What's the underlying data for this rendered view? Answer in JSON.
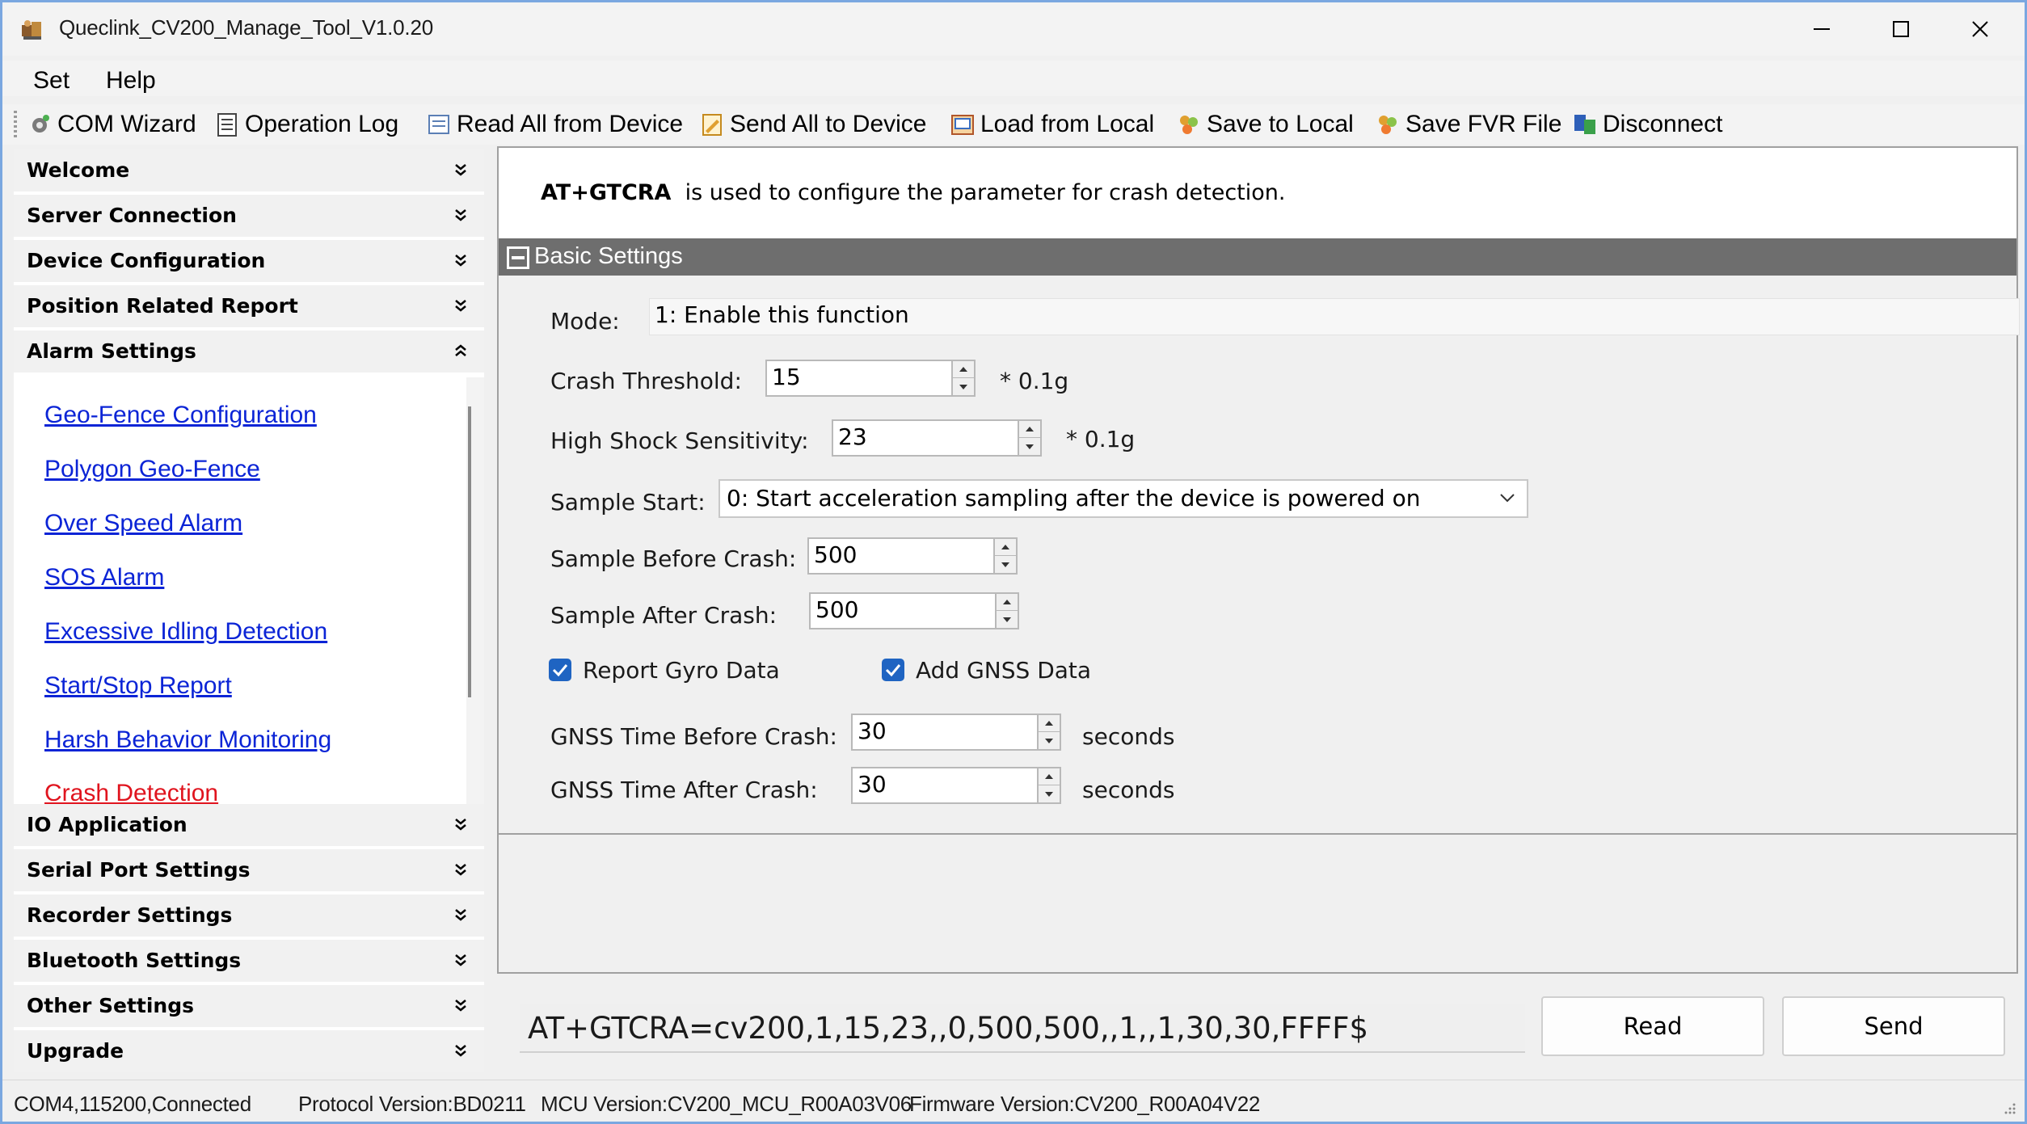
{
  "window": {
    "title": "Queclink_CV200_Manage_Tool_V1.0.20",
    "controls": {
      "minimize": "minimize",
      "maximize": "maximize",
      "close": "close"
    }
  },
  "menu": {
    "items": [
      "Set",
      "Help"
    ]
  },
  "toolbar": {
    "items": [
      {
        "label": "COM Wizard",
        "icon": "gear-icon"
      },
      {
        "label": "Operation Log",
        "icon": "log-icon"
      },
      {
        "label": "Read All from Device",
        "icon": "read-icon"
      },
      {
        "label": "Send All to Device",
        "icon": "send-icon"
      },
      {
        "label": "Load from Local",
        "icon": "load-icon"
      },
      {
        "label": "Save to Local",
        "icon": "save-icon"
      },
      {
        "label": "Save FVR File",
        "icon": "save-fvr-icon"
      },
      {
        "label": "Disconnect",
        "icon": "disconnect-icon"
      }
    ]
  },
  "sidebar": {
    "sections_top": [
      {
        "label": "Welcome",
        "state": "collapsed"
      },
      {
        "label": "Server Connection",
        "state": "collapsed"
      },
      {
        "label": "Device Configuration",
        "state": "collapsed"
      },
      {
        "label": "Position Related Report",
        "state": "collapsed"
      },
      {
        "label": "Alarm Settings",
        "state": "expanded"
      }
    ],
    "alarm_items": [
      {
        "label": "Geo-Fence Configuration",
        "active": false
      },
      {
        "label": "Polygon Geo-Fence",
        "active": false
      },
      {
        "label": "Over Speed Alarm",
        "active": false
      },
      {
        "label": "SOS Alarm",
        "active": false
      },
      {
        "label": "Excessive Idling Detection",
        "active": false
      },
      {
        "label": "Start/Stop Report",
        "active": false
      },
      {
        "label": "Harsh Behavior Monitoring",
        "active": false
      },
      {
        "label": "Crash Detection",
        "active": true
      }
    ],
    "sections_bottom": [
      {
        "label": "IO Application",
        "state": "collapsed"
      },
      {
        "label": "Serial Port Settings",
        "state": "collapsed"
      },
      {
        "label": "Recorder Settings",
        "state": "collapsed"
      },
      {
        "label": "Bluetooth Settings",
        "state": "collapsed"
      },
      {
        "label": "Other Settings",
        "state": "collapsed"
      },
      {
        "label": "Upgrade",
        "state": "collapsed"
      }
    ]
  },
  "main": {
    "description": {
      "command": "AT+GTCRA",
      "text": "is used to configure the parameter for crash detection."
    },
    "section_title": "Basic Settings",
    "mode": {
      "label": "Mode:",
      "value": "1: Enable this function"
    },
    "crash_threshold": {
      "label": "Crash Threshold:",
      "value": "15",
      "unit": "* 0.1g"
    },
    "high_shock": {
      "label": "High Shock Sensitivity:",
      "value": "23",
      "unit": "* 0.1g"
    },
    "sample_start": {
      "label": "Sample Start:",
      "value": "0: Start acceleration sampling after the device is powered on"
    },
    "sample_before": {
      "label": "Sample Before Crash:",
      "value": "500"
    },
    "sample_after": {
      "label": "Sample After Crash:",
      "value": "500"
    },
    "report_gyro": {
      "label": "Report Gyro Data",
      "checked": true
    },
    "add_gnss": {
      "label": "Add GNSS Data",
      "checked": true
    },
    "gnss_before": {
      "label": "GNSS Time Before Crash:",
      "value": "30",
      "unit": "seconds"
    },
    "gnss_after": {
      "label": "GNSS Time After Crash:",
      "value": "30",
      "unit": "seconds"
    }
  },
  "command": {
    "text": "AT+GTCRA=cv200,1,15,23,,0,500,500,,1,,1,30,30,FFFF$",
    "read_label": "Read",
    "send_label": "Send"
  },
  "status": {
    "connection": "COM4,115200,Connected",
    "protocol": "Protocol Version:BD0211",
    "mcu": "MCU Version:CV200_MCU_R00A03V06",
    "firmware": "Firmware Version:CV200_R00A04V22"
  },
  "colors": {
    "link": "#0b24d6",
    "link_active": "#e0141e",
    "section_header": "#6e6e6e",
    "checkbox": "#1f64c2",
    "window_border": "#7aa7e0"
  }
}
